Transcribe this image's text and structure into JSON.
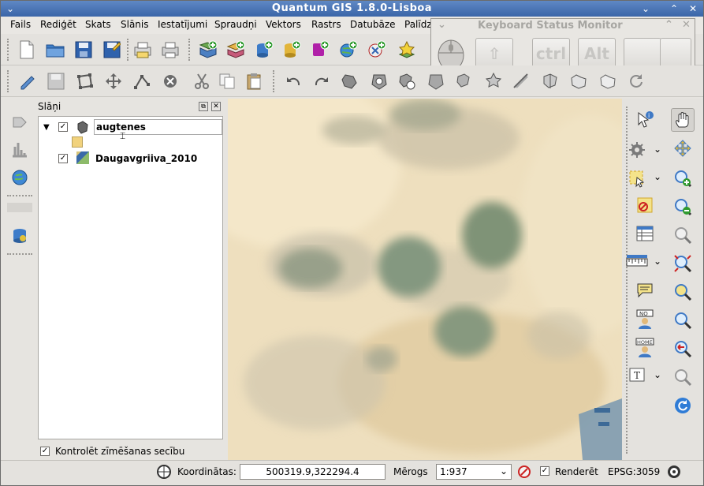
{
  "window": {
    "title": "Quantum GIS 1.8.0-Lisboa"
  },
  "menu": [
    "Fails",
    "Rediģēt",
    "Skats",
    "Slānis",
    "Iestatījumi",
    "Spraudņi",
    "Vektors",
    "Rastrs",
    "Datubāze",
    "Palīdz"
  ],
  "keyboard_monitor": {
    "title": "Keyboard Status Monitor",
    "keys": {
      "shift": "⇧",
      "ctrl": "ctrl",
      "alt": "Alt"
    }
  },
  "layers_panel": {
    "title": "Slāņi",
    "layers": [
      {
        "name": "augtenes",
        "checked": true,
        "expanded": true,
        "symbol_color": "#f1d27d"
      },
      {
        "name": "Daugavgriiva_2010",
        "checked": true
      }
    ],
    "render_order_label": "Kontrolēt zīmēšanas secību",
    "render_order_checked": true
  },
  "status": {
    "coord_label": "Koordinātas:",
    "coord_value": "500319.9,322294.4",
    "scale_label": "Mērogs",
    "scale_value": "1:937",
    "render_label": "Renderēt",
    "render_checked": true,
    "epsg": "EPSG:3059"
  },
  "colors": {
    "titlebar": "#3a65a8",
    "map_bg": "#ecdcb8",
    "vegetation": "#7f9377"
  },
  "icons": {
    "left_toolbar": [
      "new-project-icon",
      "open-project-icon",
      "save-project-icon",
      "save-as-icon",
      "print-composer-icon",
      "print-icon"
    ],
    "add_layers": [
      "add-vector-icon",
      "add-raster-icon",
      "add-postgis-icon",
      "add-spatialite-icon",
      "add-mssql-icon",
      "add-wms-icon",
      "add-wfs-icon",
      "new-shapefile-icon"
    ],
    "edit_toolbar": [
      "toggle-edit-icon",
      "save-edits-icon",
      "add-feature-icon",
      "move-feature-icon",
      "node-tool-icon",
      "delete-selected-icon",
      "cut-icon",
      "copy-icon",
      "paste-icon",
      "undo-icon",
      "redo-icon",
      "simplify-icon",
      "add-ring-icon",
      "add-part-icon",
      "delete-ring-icon",
      "delete-part-icon",
      "reshape-icon",
      "offset-curve-icon",
      "split-icon",
      "merge-icon",
      "merge-attributes-icon",
      "rotate-icon"
    ],
    "right_toolbar": [
      "identify-icon",
      "pan-icon",
      "settings-icon",
      "select-icon",
      "zoom-in-icon",
      "deselect-icon",
      "zoom-out-icon",
      "attribute-table-icon",
      "zoom-full-icon",
      "measure-icon",
      "zoom-layer-icon",
      "map-tips-icon",
      "zoom-selection-icon",
      "new-bookmark-icon",
      "zoom-last-icon",
      "show-bookmarks-icon",
      "zoom-next-icon",
      "text-annotation-icon",
      "refresh-icon"
    ]
  }
}
